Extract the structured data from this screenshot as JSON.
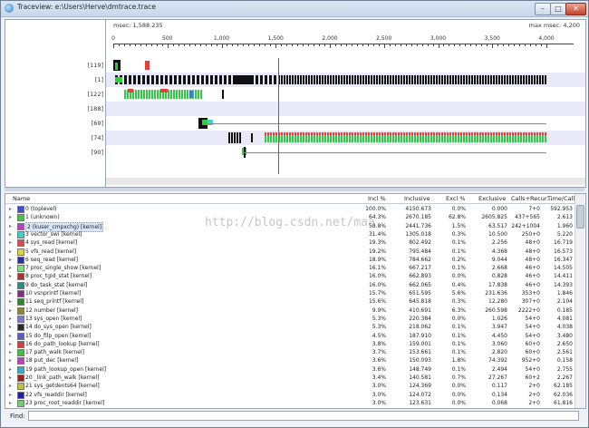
{
  "window": {
    "title": "Traceview: e:\\Users\\Herve\\dmtrace.trace"
  },
  "titlebar_buttons": {
    "minimize": "–",
    "maximize": "□",
    "close": "✕"
  },
  "timeline": {
    "msec_left": "msec: 1,588.235",
    "msec_right": "max msec: 4,200",
    "ticks": [
      "0",
      "500",
      "1,000",
      "1,500",
      "2,000",
      "2,500",
      "3,000",
      "3,500",
      "4,000"
    ],
    "threads": [
      "[119]",
      "[1]",
      "[122]",
      "[188]",
      "[69]",
      "[74]",
      "[90]"
    ]
  },
  "table": {
    "headers": {
      "name": "Name",
      "incl_pct": "Incl %",
      "inclusive": "Inclusive",
      "excl_pct": "Excl %",
      "exclusive": "Exclusive",
      "calls": "Calls+Recur...",
      "time_call": "Time/Call"
    },
    "rows": [
      {
        "name": "0 (toplevel)",
        "incl_pct": "100.0%",
        "inclusive": "4150.673",
        "excl_pct": "0.0%",
        "exclusive": "0.000",
        "calls": "7+0",
        "time_call": "592.953",
        "color": "#3c4fd0"
      },
      {
        "name": "1 (unknown)",
        "incl_pct": "64.3%",
        "inclusive": "2670.185",
        "excl_pct": "62.8%",
        "exclusive": "2605.825",
        "calls": "437+565",
        "time_call": "2.613",
        "color": "#49c049"
      },
      {
        "name": "2 (kuser_cmpxchg) [kernel]",
        "incl_pct": "58.8%",
        "inclusive": "2441.736",
        "excl_pct": "1.5%",
        "exclusive": "63.517",
        "calls": "242+1004",
        "time_call": "1.960",
        "color": "#c03acb"
      },
      {
        "name": "3 vector_swi [kernel]",
        "incl_pct": "31.4%",
        "inclusive": "1305.018",
        "excl_pct": "0.3%",
        "exclusive": "10.500",
        "calls": "250+0",
        "time_call": "5.220",
        "color": "#3fd2d2"
      },
      {
        "name": "4 sys_read [kernel]",
        "incl_pct": "19.3%",
        "inclusive": "802.492",
        "excl_pct": "0.1%",
        "exclusive": "2.256",
        "calls": "48+0",
        "time_call": "16.719",
        "color": "#e04a4a"
      },
      {
        "name": "5 vfs_read [kernel]",
        "incl_pct": "19.2%",
        "inclusive": "795.484",
        "excl_pct": "0.1%",
        "exclusive": "4.368",
        "calls": "48+0",
        "time_call": "16.573",
        "color": "#d6d638"
      },
      {
        "name": "6 seq_read [kernel]",
        "incl_pct": "18.9%",
        "inclusive": "784.662",
        "excl_pct": "0.2%",
        "exclusive": "9.044",
        "calls": "48+0",
        "time_call": "16.347",
        "color": "#2a2fa8"
      },
      {
        "name": "7 proc_single_show [kernel]",
        "incl_pct": "16.1%",
        "inclusive": "667.217",
        "excl_pct": "0.1%",
        "exclusive": "2.668",
        "calls": "46+0",
        "time_call": "14.505",
        "color": "#7ee07e"
      },
      {
        "name": "8 proc_tgid_stat [kernel]",
        "incl_pct": "16.0%",
        "inclusive": "662.893",
        "excl_pct": "0.0%",
        "exclusive": "0.828",
        "calls": "46+0",
        "time_call": "14.411",
        "color": "#b03030"
      },
      {
        "name": "9 do_task_stat [kernel]",
        "incl_pct": "16.0%",
        "inclusive": "662.065",
        "excl_pct": "0.4%",
        "exclusive": "17.838",
        "calls": "46+0",
        "time_call": "14.393",
        "color": "#2a8a8a"
      },
      {
        "name": "10 vsnprintf [kernel]",
        "incl_pct": "15.7%",
        "inclusive": "651.595",
        "excl_pct": "5.6%",
        "exclusive": "231.636",
        "calls": "353+0",
        "time_call": "1.846",
        "color": "#8a2a8a"
      },
      {
        "name": "11 seq_printf [kernel]",
        "incl_pct": "15.6%",
        "inclusive": "645.818",
        "excl_pct": "0.3%",
        "exclusive": "12.280",
        "calls": "307+0",
        "time_call": "2.104",
        "color": "#2a8a2a"
      },
      {
        "name": "12 number [kernel]",
        "incl_pct": "9.9%",
        "inclusive": "410.691",
        "excl_pct": "6.3%",
        "exclusive": "260.598",
        "calls": "2222+0",
        "time_call": "0.185",
        "color": "#8a8a2a"
      },
      {
        "name": "13 sys_open [kernel]",
        "incl_pct": "5.3%",
        "inclusive": "220.384",
        "excl_pct": "0.0%",
        "exclusive": "1.026",
        "calls": "54+0",
        "time_call": "4.081",
        "color": "#7a7ad8"
      },
      {
        "name": "14 do_sys_open [kernel]",
        "incl_pct": "5.3%",
        "inclusive": "218.062",
        "excl_pct": "0.1%",
        "exclusive": "3.947",
        "calls": "54+0",
        "time_call": "4.038",
        "color": "#2a2a2a"
      },
      {
        "name": "15 do_filp_open [kernel]",
        "incl_pct": "4.5%",
        "inclusive": "187.910",
        "excl_pct": "0.1%",
        "exclusive": "4.450",
        "calls": "54+0",
        "time_call": "3.480",
        "color": "#5a5ad0"
      },
      {
        "name": "16 do_path_lookup [kernel]",
        "incl_pct": "3.8%",
        "inclusive": "159.001",
        "excl_pct": "0.1%",
        "exclusive": "3.060",
        "calls": "60+0",
        "time_call": "2.650",
        "color": "#d04040"
      },
      {
        "name": "17 path_walk [kernel]",
        "incl_pct": "3.7%",
        "inclusive": "153.661",
        "excl_pct": "0.1%",
        "exclusive": "2.820",
        "calls": "60+0",
        "time_call": "2.561",
        "color": "#40c040"
      },
      {
        "name": "18 put_dec [kernel]",
        "incl_pct": "3.6%",
        "inclusive": "150.093",
        "excl_pct": "1.8%",
        "exclusive": "74.392",
        "calls": "952+0",
        "time_call": "0.158",
        "color": "#c040c0"
      },
      {
        "name": "19 path_lookup_open [kernel]",
        "incl_pct": "3.6%",
        "inclusive": "148.749",
        "excl_pct": "0.1%",
        "exclusive": "2.494",
        "calls": "54+0",
        "time_call": "2.755",
        "color": "#30b0d0"
      },
      {
        "name": "20 _link_path_walk [kernel]",
        "incl_pct": "3.4%",
        "inclusive": "140.581",
        "excl_pct": "0.7%",
        "exclusive": "27.267",
        "calls": "60+2",
        "time_call": "2.267",
        "color": "#a02020"
      },
      {
        "name": "21 sys_getdents64 [kernel]",
        "incl_pct": "3.0%",
        "inclusive": "124.369",
        "excl_pct": "0.0%",
        "exclusive": "0.117",
        "calls": "2+0",
        "time_call": "62.185",
        "color": "#c0c040"
      },
      {
        "name": "22 vfs_readdir [kernel]",
        "incl_pct": "3.0%",
        "inclusive": "124.072",
        "excl_pct": "0.0%",
        "exclusive": "0.134",
        "calls": "2+0",
        "time_call": "62.036",
        "color": "#2020a0"
      },
      {
        "name": "23 proc_root_readdir [kernel]",
        "incl_pct": "3.0%",
        "inclusive": "123.631",
        "excl_pct": "0.0%",
        "exclusive": "0.068",
        "calls": "2+0",
        "time_call": "61.816",
        "color": "#70d070"
      }
    ]
  },
  "watermark": "http://blog.csdn.net/maa",
  "find": {
    "label": "Find:",
    "value": ""
  }
}
